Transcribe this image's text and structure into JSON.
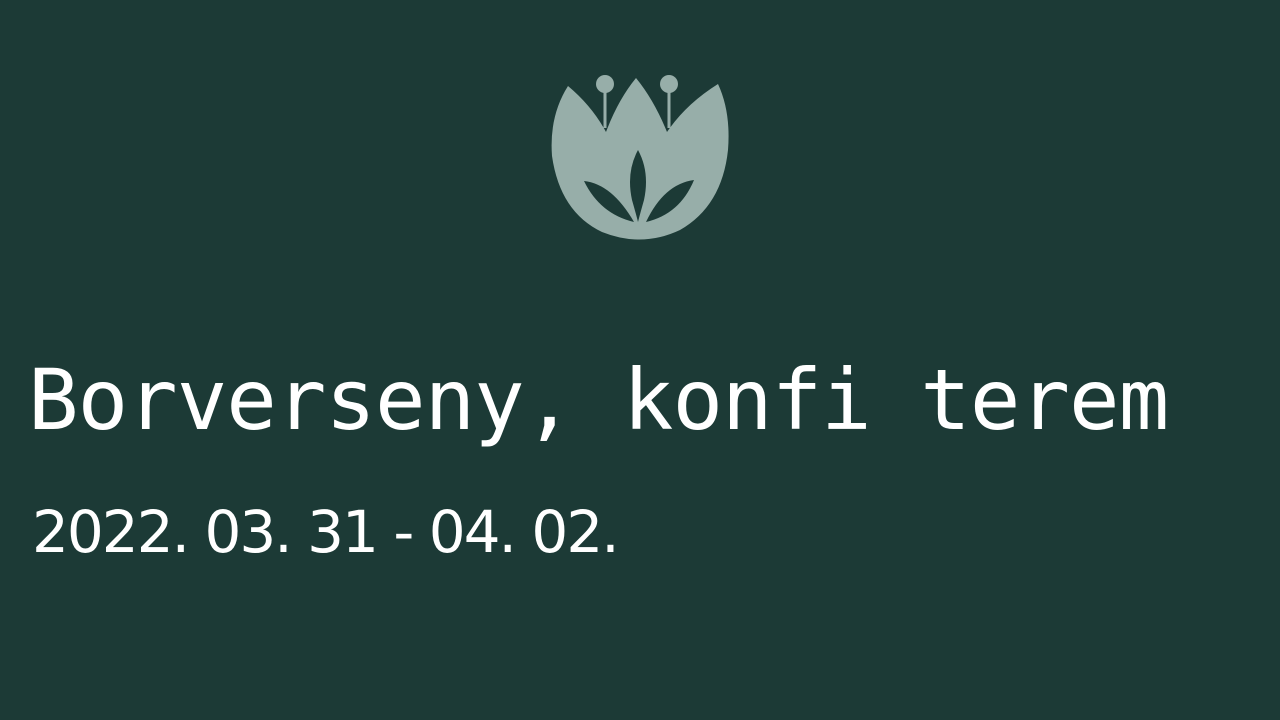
{
  "colors": {
    "background": "#1c3a36",
    "logo": "#97aea9",
    "text": "#ffffff"
  },
  "logo": {
    "icon": "lotus-flower-icon"
  },
  "event": {
    "title": "Borverseny, konfi terem",
    "date": "2022. 03. 31 - 04. 02."
  }
}
